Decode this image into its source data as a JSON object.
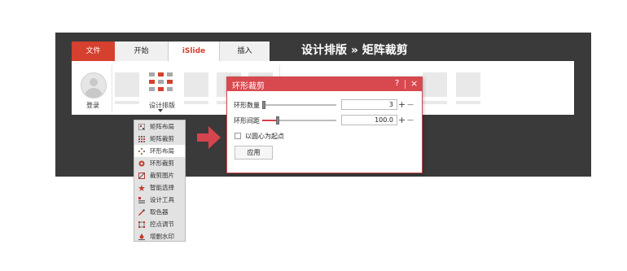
{
  "headline": "设计排版 » 矩阵裁剪",
  "tabs": [
    {
      "label": "文件"
    },
    {
      "label": "开始"
    },
    {
      "label": "iSlide"
    },
    {
      "label": "插入"
    }
  ],
  "ribbon": {
    "login_label": "登录",
    "design_label": "设计排版"
  },
  "menu": {
    "items": [
      {
        "label": "矩阵布局",
        "icon": "matrix-layout-icon"
      },
      {
        "label": "矩阵裁剪",
        "icon": "matrix-crop-icon"
      },
      {
        "label": "环形布局",
        "icon": "ring-layout-icon"
      },
      {
        "label": "环形裁剪",
        "icon": "ring-crop-icon"
      },
      {
        "label": "裁剪图片",
        "icon": "crop-image-icon"
      },
      {
        "label": "智能选择",
        "icon": "smart-select-icon"
      },
      {
        "label": "设计工具",
        "icon": "design-tools-icon"
      },
      {
        "label": "取色器",
        "icon": "color-picker-icon"
      },
      {
        "label": "控点调节",
        "icon": "handle-adjust-icon"
      },
      {
        "label": "增删水印",
        "icon": "watermark-icon"
      }
    ],
    "selected": "环形布局"
  },
  "dialog": {
    "title": "环形裁剪",
    "help": "?",
    "close": "×",
    "count_label": "环形数量",
    "count_value": "3",
    "spacing_label": "环形间距",
    "spacing_value": "100.0",
    "plus": "+",
    "minus": "—",
    "checkbox_label": "以圆心为起点",
    "checkbox_checked": false,
    "apply_label": "应用"
  },
  "colors": {
    "accent_red": "#d6402e",
    "dialog_red": "#d8494f",
    "frame_dark": "#3a3a3a"
  }
}
